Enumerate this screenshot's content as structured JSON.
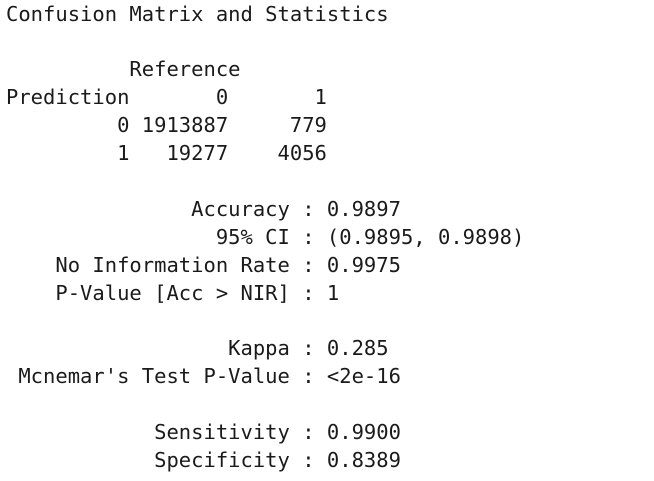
{
  "output": {
    "title": "Confusion Matrix and Statistics",
    "reference_header": "          Reference",
    "prediction_header": "Prediction       0       1",
    "matrix_row_0": "         0 1913887     779",
    "matrix_row_1": "         1   19277    4056",
    "accuracy": "               Accuracy : 0.9897",
    "ci_95": "                 95% CI : (0.9895, 0.9898)",
    "no_information_rate": "    No Information Rate : 0.9975",
    "p_value_acc_nir": "    P-Value [Acc > NIR] : 1",
    "kappa": "                  Kappa : 0.285",
    "mcnemar": " Mcnemar's Test P-Value : <2e-16",
    "sensitivity": "            Sensitivity : 0.9900",
    "specificity": "            Specificity : 0.8389"
  }
}
